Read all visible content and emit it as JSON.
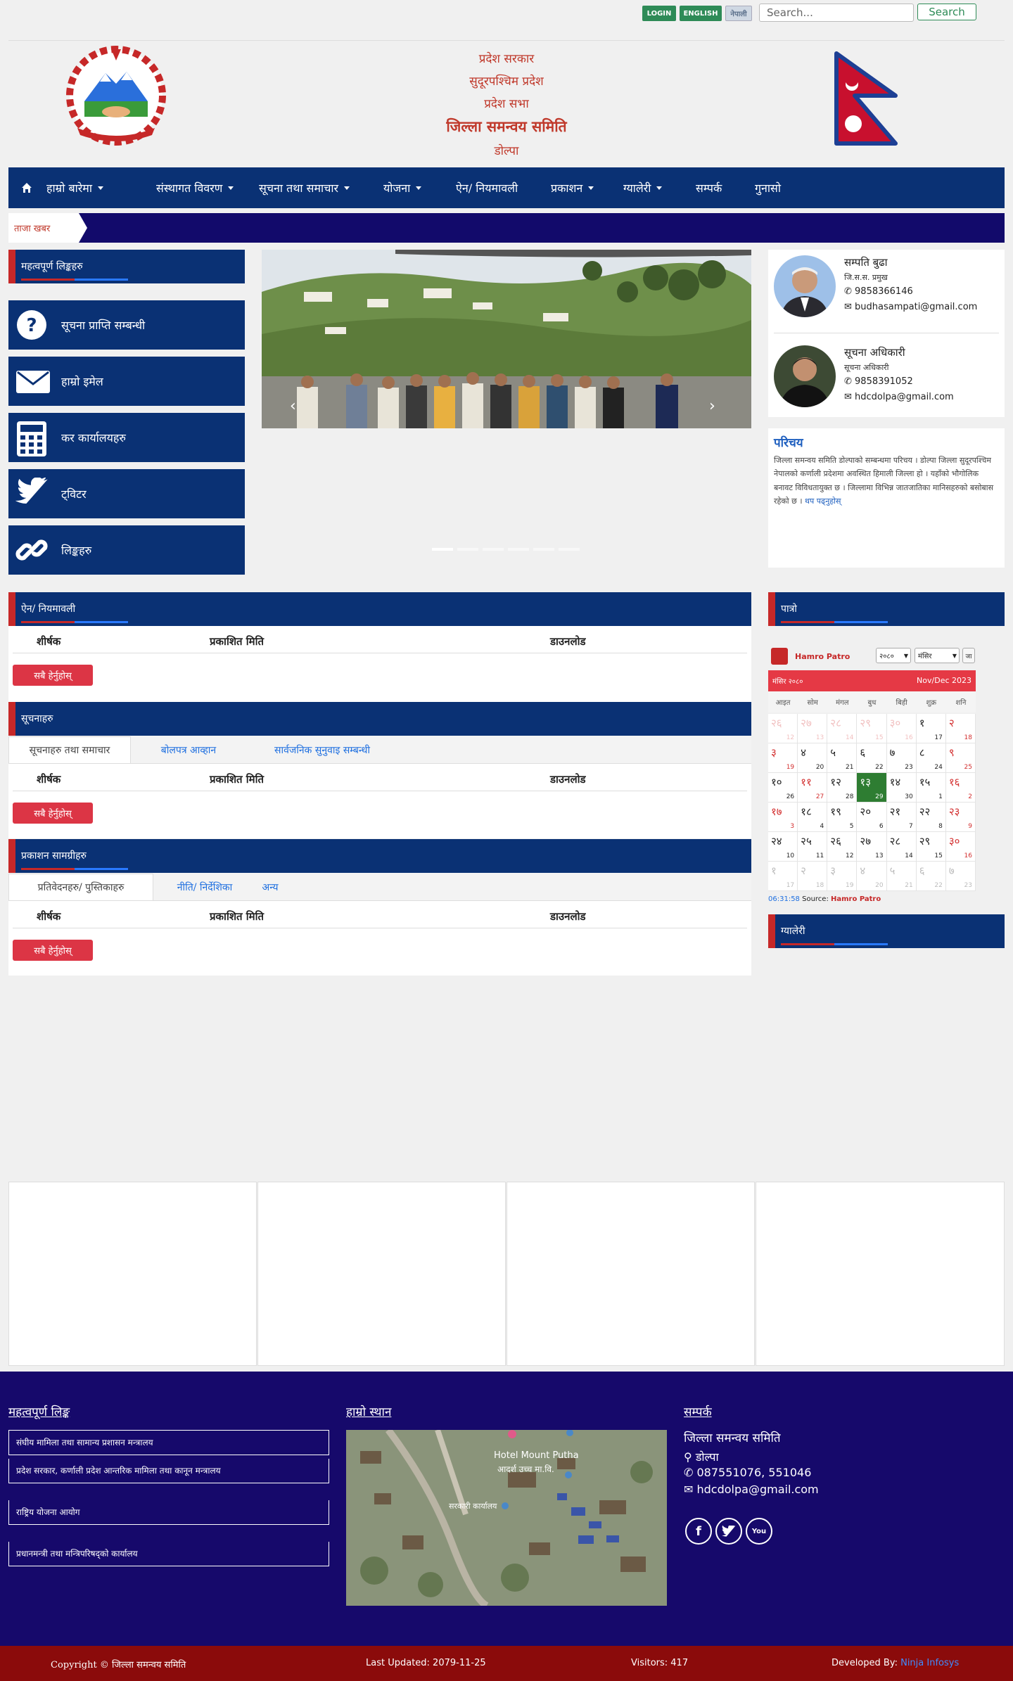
{
  "topbar": {
    "login_label": "LOGIN",
    "english_label": "ENGLISH",
    "nepali_label": "नेपाली",
    "search_placeholder": "Search...",
    "search_button": "Search"
  },
  "header": {
    "line1": "प्रदेश सरकार",
    "line2": "सुदूरपश्चिम प्रदेश",
    "line3": "प्रदेश सभा",
    "office_name": "जिल्ला समन्वय समिति",
    "location": "डोल्पा"
  },
  "nav": {
    "home_icon": "home-icon",
    "items": [
      {
        "label": "हाम्रो बारेमा",
        "dropdown": true
      },
      {
        "label": "संस्थागत विवरण",
        "dropdown": true
      },
      {
        "label": "सूचना तथा समाचार",
        "dropdown": true
      },
      {
        "label": "योजना",
        "dropdown": true
      },
      {
        "label": "ऐन/ नियमावली",
        "dropdown": false
      },
      {
        "label": "प्रकाशन",
        "dropdown": true
      },
      {
        "label": "ग्यालेरी",
        "dropdown": true
      },
      {
        "label": "सम्पर्क",
        "dropdown": false
      },
      {
        "label": "गुनासो",
        "dropdown": false
      }
    ]
  },
  "ticker": {
    "label": "ताजा खबर"
  },
  "left_sidebar": {
    "title": "महत्वपूर्ण लिङ्कहरु",
    "links": [
      {
        "label": "सूचना प्राप्ति सम्बन्धी",
        "icon": "question-icon"
      },
      {
        "label": "हाम्रो इमेल",
        "icon": "envelope-icon"
      },
      {
        "label": "कर कार्यालयहरु",
        "icon": "calculator-icon"
      },
      {
        "label": "ट्विटर",
        "icon": "twitter-icon"
      },
      {
        "label": "लिङ्कहरु",
        "icon": "link-icon"
      }
    ]
  },
  "staff": [
    {
      "name": "सम्पति बुढा",
      "role": "जि.स.स. प्रमुख",
      "phone": "9858366146",
      "email": "budhasampati@gmail.com"
    },
    {
      "name": "सूचना अधिकारी",
      "role": "सूचना अधिकारी",
      "phone": "9858391052",
      "email": "hdcdolpa@gmail.com"
    }
  ],
  "intro": {
    "title": "परिचय",
    "body": "जिल्ला समन्वय समिति डोल्पाको सम्बन्धमा परिचय । डोल्पा जिल्ला सुदूरपश्चिम नेपालको कर्णाली प्रदेशमा अवस्थित हिमाली जिल्ला हो । यहाँको भौगोलिक बनावट विविधतायुक्त छ । जिल्लामा विभिन्न जातजातिका मानिसहरुको बसोबास रहेको छ ।",
    "more_link": "थप पढ्नुहोस्"
  },
  "acts": {
    "title": "ऐन/ नियमावली",
    "columns": [
      "शीर्षक",
      "प्रकाशित मिति",
      "डाउनलोड"
    ],
    "view_all": "सबै हेर्नुहोस्"
  },
  "notices": {
    "title": "सूचनाहरु",
    "tabs": [
      "सूचनाहरु तथा समाचार",
      "बोलपत्र आव्हान",
      "सार्वजनिक सुनुवाइ सम्बन्धी"
    ],
    "columns": [
      "शीर्षक",
      "प्रकाशित मिति",
      "डाउनलोड"
    ],
    "view_all": "सबै हेर्नुहोस्"
  },
  "publications": {
    "title": "प्रकाशन सामग्रीहरु",
    "tabs": [
      "प्रतिवेदनहरु/ पुस्तिकाहरु",
      "नीति/ निर्देशिका",
      "अन्य"
    ],
    "columns": [
      "शीर्षक",
      "प्रकाशित मिति",
      "डाउनलोड"
    ],
    "view_all": "सबै हेर्नुहोस्"
  },
  "calendar_widget": {
    "title": "पात्रो",
    "brand": "Hamro Patro",
    "year_select": "२०८०",
    "month_select": "मंसिर",
    "go_label": "जा",
    "month_label": "मंसिर २०८०",
    "eng_label": "Nov/Dec 2023",
    "weekdays": [
      "आइत",
      "सोम",
      "मंगल",
      "बुध",
      "बिही",
      "शुक्र",
      "शनि"
    ],
    "days": [
      [
        "२६",
        "12",
        true,
        true
      ],
      [
        "२७",
        "13",
        true,
        true
      ],
      [
        "२८",
        "14",
        true,
        true
      ],
      [
        "२९",
        "15",
        true,
        true
      ],
      [
        "३०",
        "16",
        true,
        true
      ],
      [
        "१",
        "17",
        false,
        false
      ],
      [
        "२",
        "18",
        false,
        true
      ],
      [
        "३",
        "19",
        false,
        true
      ],
      [
        "४",
        "20",
        false,
        false
      ],
      [
        "५",
        "21",
        false,
        false
      ],
      [
        "६",
        "22",
        false,
        false
      ],
      [
        "७",
        "23",
        false,
        false
      ],
      [
        "८",
        "24",
        false,
        false
      ],
      [
        "९",
        "25",
        false,
        true
      ],
      [
        "१०",
        "26",
        false,
        false
      ],
      [
        "११",
        "27",
        false,
        true
      ],
      [
        "१२",
        "28",
        false,
        false
      ],
      [
        "१३",
        "29",
        false,
        false
      ],
      [
        "१४",
        "30",
        false,
        false
      ],
      [
        "१५",
        "1",
        false,
        false
      ],
      [
        "१६",
        "2",
        false,
        true
      ],
      [
        "१७",
        "3",
        false,
        true
      ],
      [
        "१८",
        "4",
        false,
        false
      ],
      [
        "१९",
        "5",
        false,
        false
      ],
      [
        "२०",
        "6",
        false,
        false
      ],
      [
        "२१",
        "7",
        false,
        false
      ],
      [
        "२२",
        "8",
        false,
        false
      ],
      [
        "२३",
        "9",
        false,
        true
      ],
      [
        "२४",
        "10",
        false,
        false
      ],
      [
        "२५",
        "11",
        false,
        false
      ],
      [
        "२६",
        "12",
        false,
        false
      ],
      [
        "२७",
        "13",
        false,
        false
      ],
      [
        "२८",
        "14",
        false,
        false
      ],
      [
        "२९",
        "15",
        false,
        false
      ],
      [
        "३०",
        "16",
        false,
        true
      ],
      [
        "१",
        "17",
        true,
        false
      ],
      [
        "२",
        "18",
        true,
        false
      ],
      [
        "३",
        "19",
        true,
        false
      ],
      [
        "४",
        "20",
        true,
        false
      ],
      [
        "५",
        "21",
        true,
        false
      ],
      [
        "६",
        "22",
        true,
        false
      ],
      [
        "७",
        "23",
        true,
        false
      ]
    ],
    "today_index": 17,
    "time": "06:31:58",
    "source_label": "Source:",
    "source_name": "Hamro Patro"
  },
  "gallery": {
    "title": "ग्यालेरी"
  },
  "footer": {
    "links_title": "महत्वपूर्ण लिङ्क",
    "links": [
      "संघीय मामिला तथा सामान्य प्रशासन मन्त्रालय",
      "प्रदेश सरकार, कर्णाली प्रदेश आन्तरिक मामिला तथा कानून मन्त्रालय",
      "राष्ट्रिय योजना आयोग",
      "प्रधानमन्त्री तथा मन्त्रिपरिषद्को कार्यालय"
    ],
    "map_title": "हाम्रो स्थान",
    "map_labels": [
      "Hotel Mount Putha",
      "आदर्श उच्च मा.वि.",
      "सरकारी कार्यालय"
    ],
    "contact_title": "सम्पर्क",
    "contact_name": "जिल्ला समन्वय समिति",
    "contact_address": "डोल्पा",
    "contact_phone": "087551076, 551046",
    "contact_email": "hdcdolpa@gmail.com",
    "copyright": "Copyright © जिल्ला समन्वय समिति",
    "last_updated": "Last Updated: 2079-11-25",
    "visitors": "Visitors: 417",
    "developed_by_label": "Developed By:",
    "developer": "Ninja Infosys"
  },
  "colors": {
    "navy": "#0a3174",
    "deep_blue": "#16096b",
    "accent_red": "#c62828",
    "footer_red": "#8b0b0b",
    "green": "#2e8b57"
  }
}
